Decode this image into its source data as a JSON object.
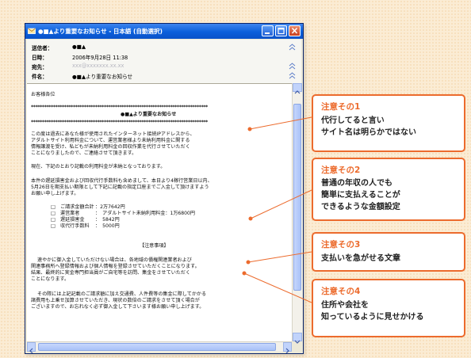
{
  "window": {
    "title": "●■▲より重要なお知らせ - 日本語 (自動選択)"
  },
  "header": {
    "rows": [
      {
        "label": "送信者：",
        "value": "●■▲"
      },
      {
        "label": "日時：",
        "value": "2006年9月28日 11:38"
      },
      {
        "label": "宛先：",
        "value": "xxx@xxxxxxx.xx.xx"
      },
      {
        "label": "件名：",
        "value": "●■▲より重要なお知らせ"
      }
    ]
  },
  "email": {
    "greeting": "お客様各位",
    "stars": "********************************************************************************",
    "subject_line": "●■▲より重要なお知らせ",
    "para1": [
      "この度は過去にあなた様が使用されたインターネット接続IPアドレスから、",
      "アダルトサイト利用料金について、運営業者様より未納利用料金に関する",
      "情報譲渡を受け、私どもが未納利用料金の回収作業を代行させていただく",
      "ことになりましたので、ご連絡させて頂きます。"
    ],
    "para2": "現在、下記のとおり記載の利用料金が未納となっております。",
    "para3": [
      "本件の遅延損害金および回収代行手数料も含めまして、本日より4稼行営業日以内、",
      "5月26日を期支払い期限として下記に記載の指定口座までご入金して頂けますよう",
      "お願い申し上げます。"
    ],
    "charges": [
      {
        "mark": "□",
        "label": "ご請求金額合計",
        "value": "：2万7642円"
      },
      {
        "mark": "□",
        "label": "運営業者",
        "value": "：　アダルトサイト未納利用料金：1万6800円"
      },
      {
        "mark": "□",
        "label": "遅延損害金",
        "value": "：　5842円"
      },
      {
        "mark": "□",
        "label": "収代行手数料",
        "value": "：　5000円"
      }
    ],
    "notice_heading": "【注意事項】",
    "para4": [
      "速やかに御入金していただけない場合は、各地域の債権関連業者および",
      "関連事務所へ登録情報および個人情報を登録させていただくことになります。",
      "結果、最終的に実金専門担当員がご自宅等を訪問、集金をさせていただく",
      "ことになります。"
    ],
    "para5": [
      "その際には上記記載のご請求額に加え交通費、人件費等の集金に際してかかる",
      "諸費用も上乗せ加算させていただき、現状の数倍のご請求をさせて頂く場合が",
      "ございますので、お忘れなく必ず御入金して下さいます様お願い申し上げます。"
    ]
  },
  "callouts": [
    {
      "title": "注意その1",
      "lines": [
        "代行してると言い",
        "サイト名は明らかではない"
      ]
    },
    {
      "title": "注意その2",
      "lines": [
        "普通の年収の人でも",
        "簡単に支払えることが",
        "できるような金額設定"
      ]
    },
    {
      "title": "注意その3",
      "lines": [
        "支払いを急がせる文章"
      ]
    },
    {
      "title": "注意その4",
      "lines": [
        "住所や会社を",
        "知っているように見せかける"
      ]
    }
  ],
  "colors": {
    "accent": "#ec6b2d",
    "titlebar": "#0b5fdb",
    "background": "#fbecd4"
  }
}
